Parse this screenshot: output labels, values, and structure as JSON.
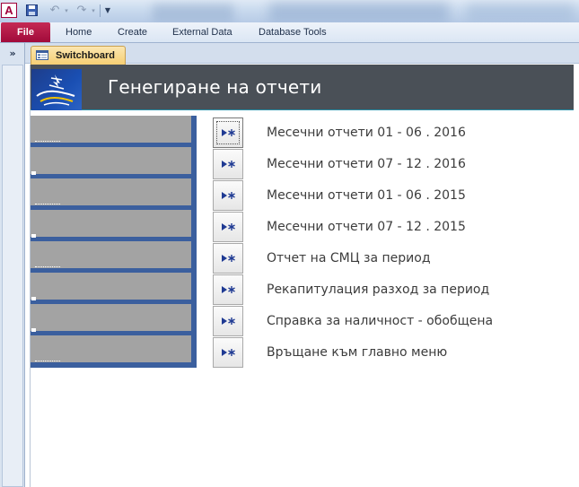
{
  "quick_access": {
    "app_icon_letter": "A",
    "icons": [
      "access-app-icon",
      "save-icon",
      "undo-icon",
      "redo-icon",
      "customize-toolbar-icon"
    ]
  },
  "ribbon": {
    "file_label": "File",
    "tabs": [
      {
        "label": "Home"
      },
      {
        "label": "Create"
      },
      {
        "label": "External Data"
      },
      {
        "label": "Database Tools"
      }
    ]
  },
  "navigation_pane": {
    "toggle_glyph": "»"
  },
  "document_tab": {
    "label": "Switchboard",
    "icon": "form-icon"
  },
  "form": {
    "title": "Генегиране на отчети",
    "items": [
      {
        "label": "Месечни отчети 01 - 06 . 2016"
      },
      {
        "label": "Месечни отчети 07 - 12 . 2016"
      },
      {
        "label": "Месечни отчети 01 - 06 . 2015"
      },
      {
        "label": "Месечни отчети 07 - 12 . 2015"
      },
      {
        "label": "Отчет на СМЦ за период"
      },
      {
        "label": "Рекапитулация разход за период"
      },
      {
        "label": "Справка за наличност - обобщена"
      },
      {
        "label": "Връщане към главно меню"
      }
    ]
  },
  "colors": {
    "file_tab": "#a10a3a",
    "header_band": "#4a5057",
    "left_panel": "#3b5f9e",
    "grey_bar": "#a3a3a3",
    "doc_tab": "#f6cf73",
    "button_icon": "#1f3a93"
  }
}
